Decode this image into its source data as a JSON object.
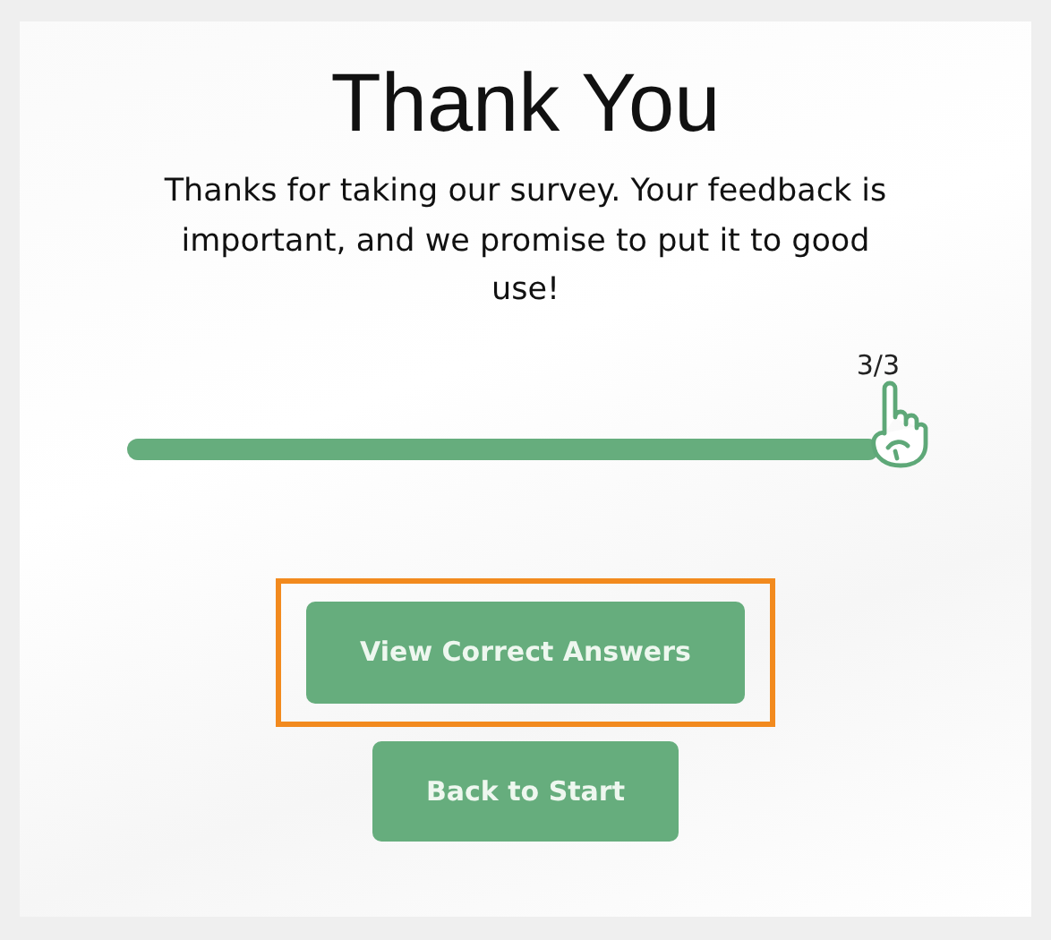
{
  "title": "Thank You",
  "message": "Thanks for taking our survey. Your feedback is important, and we promise to put it to good use!",
  "progress": {
    "reading": "3/3",
    "level": 1.0
  },
  "buttons": [
    {
      "label": "View Correct Answers",
      "highlighted": true
    },
    {
      "label": "Back to Start",
      "highlighted": false
    }
  ]
}
